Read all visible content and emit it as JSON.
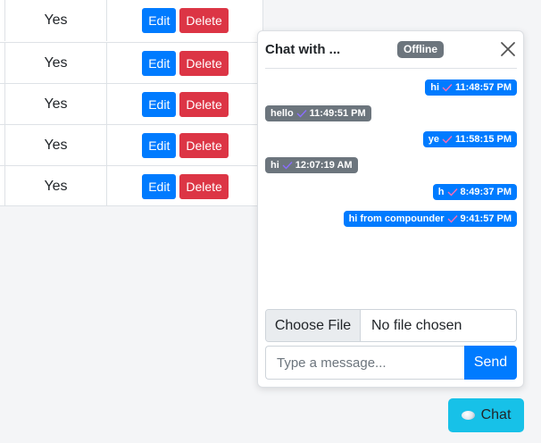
{
  "table": {
    "rows": [
      {
        "value": "Yes",
        "edit_label": "Edit",
        "delete_label": "Delete"
      },
      {
        "value": "Yes",
        "edit_label": "Edit",
        "delete_label": "Delete"
      },
      {
        "value": "Yes",
        "edit_label": "Edit",
        "delete_label": "Delete"
      },
      {
        "value": "Yes",
        "edit_label": "Edit",
        "delete_label": "Delete"
      },
      {
        "value": "Yes",
        "edit_label": "Edit",
        "delete_label": "Delete"
      }
    ]
  },
  "chat": {
    "title": "Chat with ...",
    "status": "Offline",
    "close_icon": "close-icon",
    "messages": [
      {
        "text": "hi",
        "time": "11:48:57 PM",
        "direction": "sent"
      },
      {
        "text": "hello",
        "time": "11:49:51 PM",
        "direction": "received"
      },
      {
        "text": "ye",
        "time": "11:58:15 PM",
        "direction": "sent"
      },
      {
        "text": "hi",
        "time": "12:07:19 AM",
        "direction": "received"
      },
      {
        "text": "h",
        "time": "8:49:37 PM",
        "direction": "sent"
      },
      {
        "text": "hi from compounder",
        "time": "9:41:57 PM",
        "direction": "sent"
      }
    ],
    "file": {
      "button_label": "Choose File",
      "status": "No file chosen"
    },
    "input": {
      "placeholder": "Type a message...",
      "value": ""
    },
    "send_label": "Send"
  },
  "fab": {
    "label": "Chat",
    "icon": "chat-bubble-icon"
  },
  "colors": {
    "primary": "#007bff",
    "danger": "#dc3545",
    "secondary": "#6c757d",
    "info": "#17c1e8"
  }
}
